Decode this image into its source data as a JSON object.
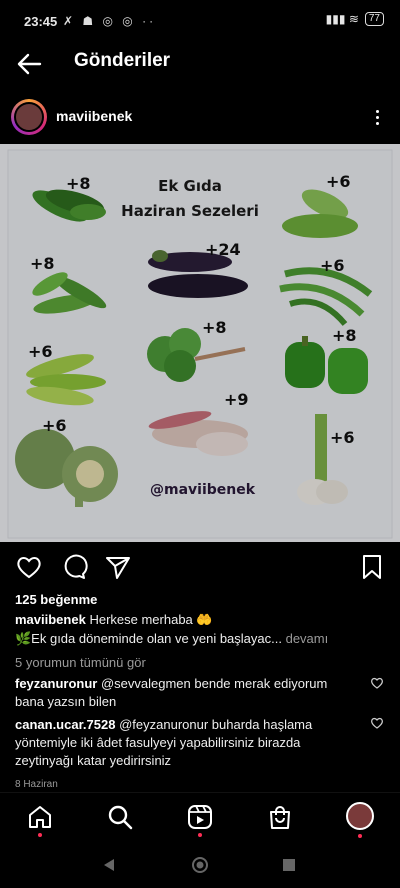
{
  "status_bar": {
    "time": "23:45",
    "left_icons": "✗ ☗ ◎ ◎ ··",
    "signal_icons": "▮▮▮ ≋",
    "battery": "77"
  },
  "header": {
    "title": "Gönderiler"
  },
  "post": {
    "username": "maviibenek",
    "image": {
      "title_line1": "Ek Gıda",
      "title_line2": "Haziran Sezeleri",
      "counts": [
        "+8",
        "+6",
        "+8",
        "+24",
        "+6",
        "+6",
        "+8",
        "+8",
        "+6",
        "+9",
        "+6"
      ],
      "watermark": "@maviibenek"
    },
    "likes": "125 beğenme",
    "caption": {
      "user": "maviibenek",
      "line1": "Herkese merhaba 🤲",
      "line2": "🌿Ek gıda döneminde olan ve yeni başlayac...",
      "more": "devamı"
    },
    "view_comments": "5 yorumun tümünü gör",
    "comments": [
      {
        "user": "feyzanuronur",
        "text": "@sevvalegmen bende merak ediyorum bana yazsın bilen"
      },
      {
        "user": "canan.ucar.7528",
        "text": "@feyzanuronur buharda haşlama yöntemiyle iki âdet fasulyeyi yapabilirsiniz birazda zeytinyağı katar yedirirsiniz"
      }
    ],
    "date": "8 Haziran"
  },
  "icons": {
    "back": "back-arrow-icon",
    "like": "heart-icon",
    "comment": "comment-icon",
    "share": "send-icon",
    "save": "bookmark-icon",
    "home": "home-icon",
    "search": "search-icon",
    "reels": "reels-icon",
    "shop": "shop-icon"
  },
  "colors": {
    "background": "#000000",
    "notification_dot": "#ff2d55",
    "image_bg": "#f0f1f4"
  }
}
